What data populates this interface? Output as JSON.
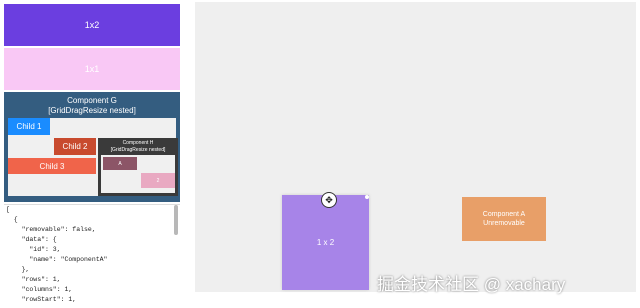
{
  "sidebar": {
    "tile_1x2_label": "1x2",
    "tile_pink_label": "1x1",
    "component_g": {
      "title_line1": "Component G",
      "title_line2": "[GridDragResize nested]",
      "child1": "Child 1",
      "child2": "Child 2",
      "child3": "Child 3",
      "component_h": {
        "title_line1": "Component H",
        "title_line2": "[GridDragResize nested]",
        "cell_a": "A",
        "cell_2": "2"
      }
    },
    "json_lines": [
      "[",
      "  {",
      "    \"removable\": false,",
      "    \"data\": {",
      "      \"id\": 3,",
      "      \"name\": \"ComponentA\"",
      "    },",
      "    \"rows\": 1,",
      "    \"columns\": 1,",
      "    \"rowStart\": 1,"
    ]
  },
  "canvas": {
    "card_1x2_label": "1 x 2",
    "card_a_line1": "Component A",
    "card_a_line2": "Unremovable",
    "move_symbol": "✥"
  },
  "watermark": "掘金技术社区 @ xachary",
  "colors": {
    "purple": "#6b3ee0",
    "pink": "#f9c8f5",
    "steel_blue": "#345d80",
    "lavender": "#a784e8",
    "orange": "#e89f68"
  }
}
